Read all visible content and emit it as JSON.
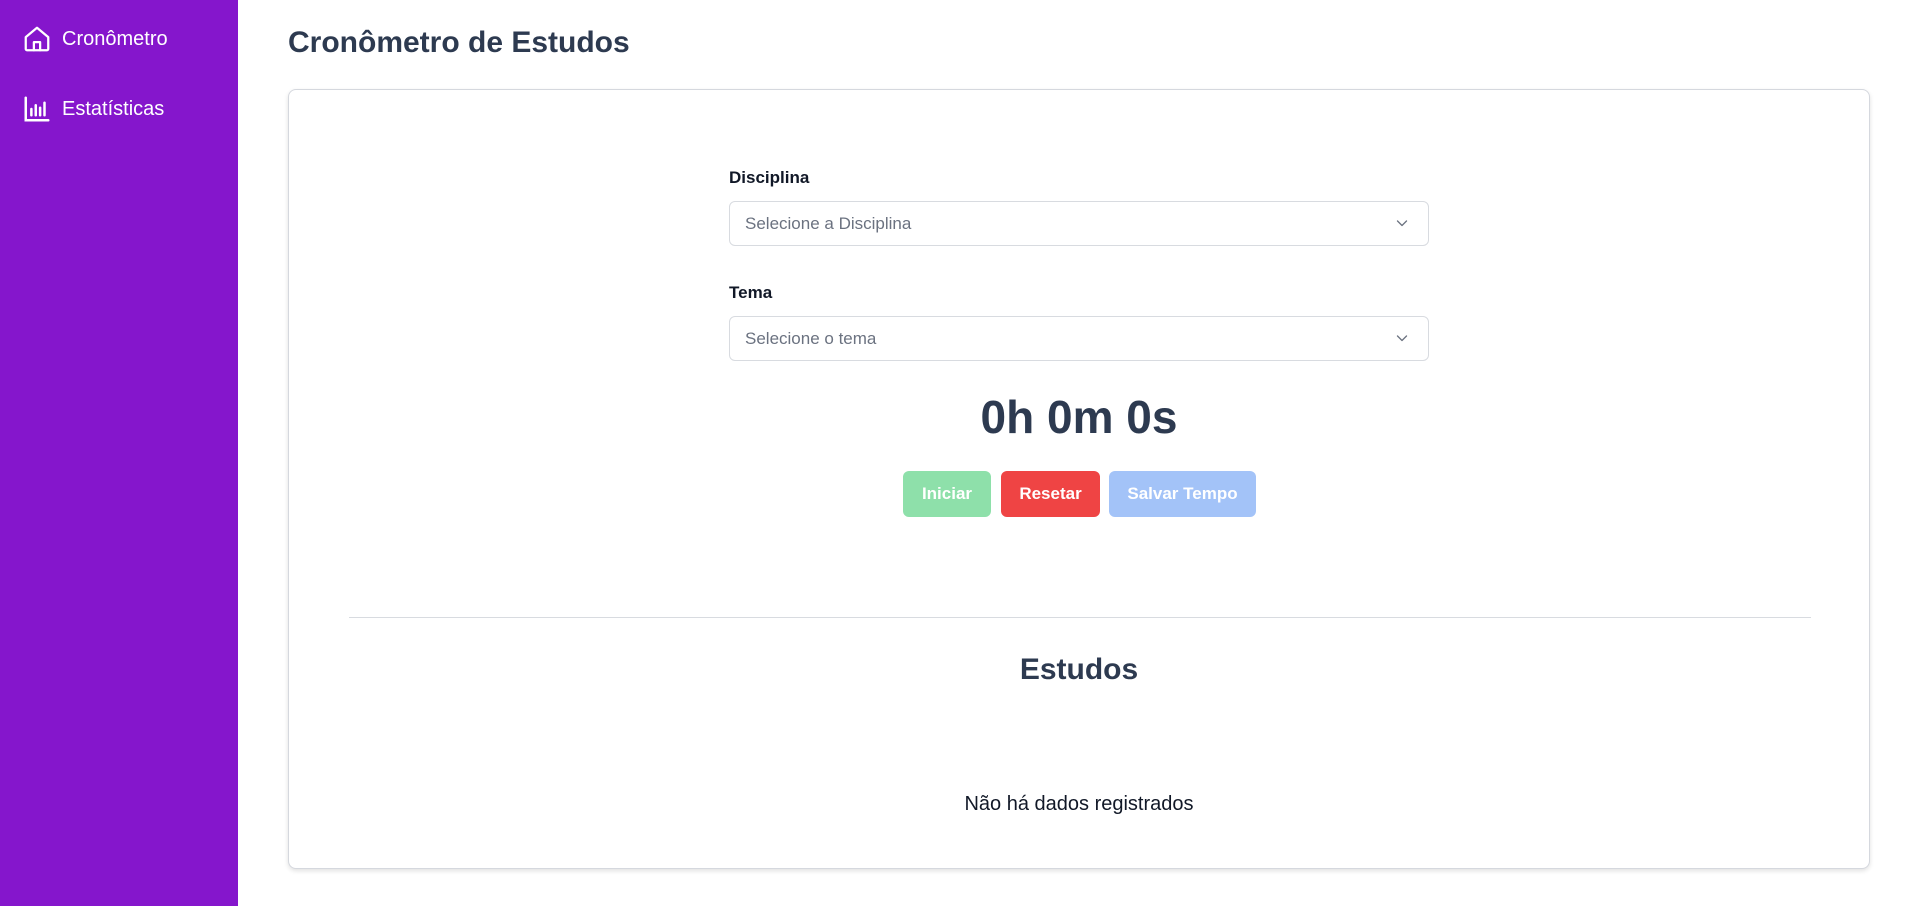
{
  "sidebar": {
    "bg_color": "#8516cc",
    "items": [
      {
        "label": "Cronômetro",
        "icon": "home-icon"
      },
      {
        "label": "Estatísticas",
        "icon": "bar-chart-icon"
      }
    ]
  },
  "header": {
    "title": "Cronômetro de Estudos"
  },
  "form": {
    "discipline_label": "Disciplina",
    "discipline_placeholder": "Selecione a Disciplina",
    "topic_label": "Tema",
    "topic_placeholder": "Selecione o tema"
  },
  "timer": {
    "display": "0h 0m 0s"
  },
  "buttons": {
    "start": "Iniciar",
    "reset": "Resetar",
    "save": "Salvar Tempo"
  },
  "studies": {
    "title": "Estudos",
    "empty_message": "Não há dados registrados"
  },
  "colors": {
    "accent": "#8516cc",
    "heading": "#2d3a50",
    "start": "#8ee0aa",
    "reset": "#ef4444",
    "save": "#a3c3f8"
  }
}
